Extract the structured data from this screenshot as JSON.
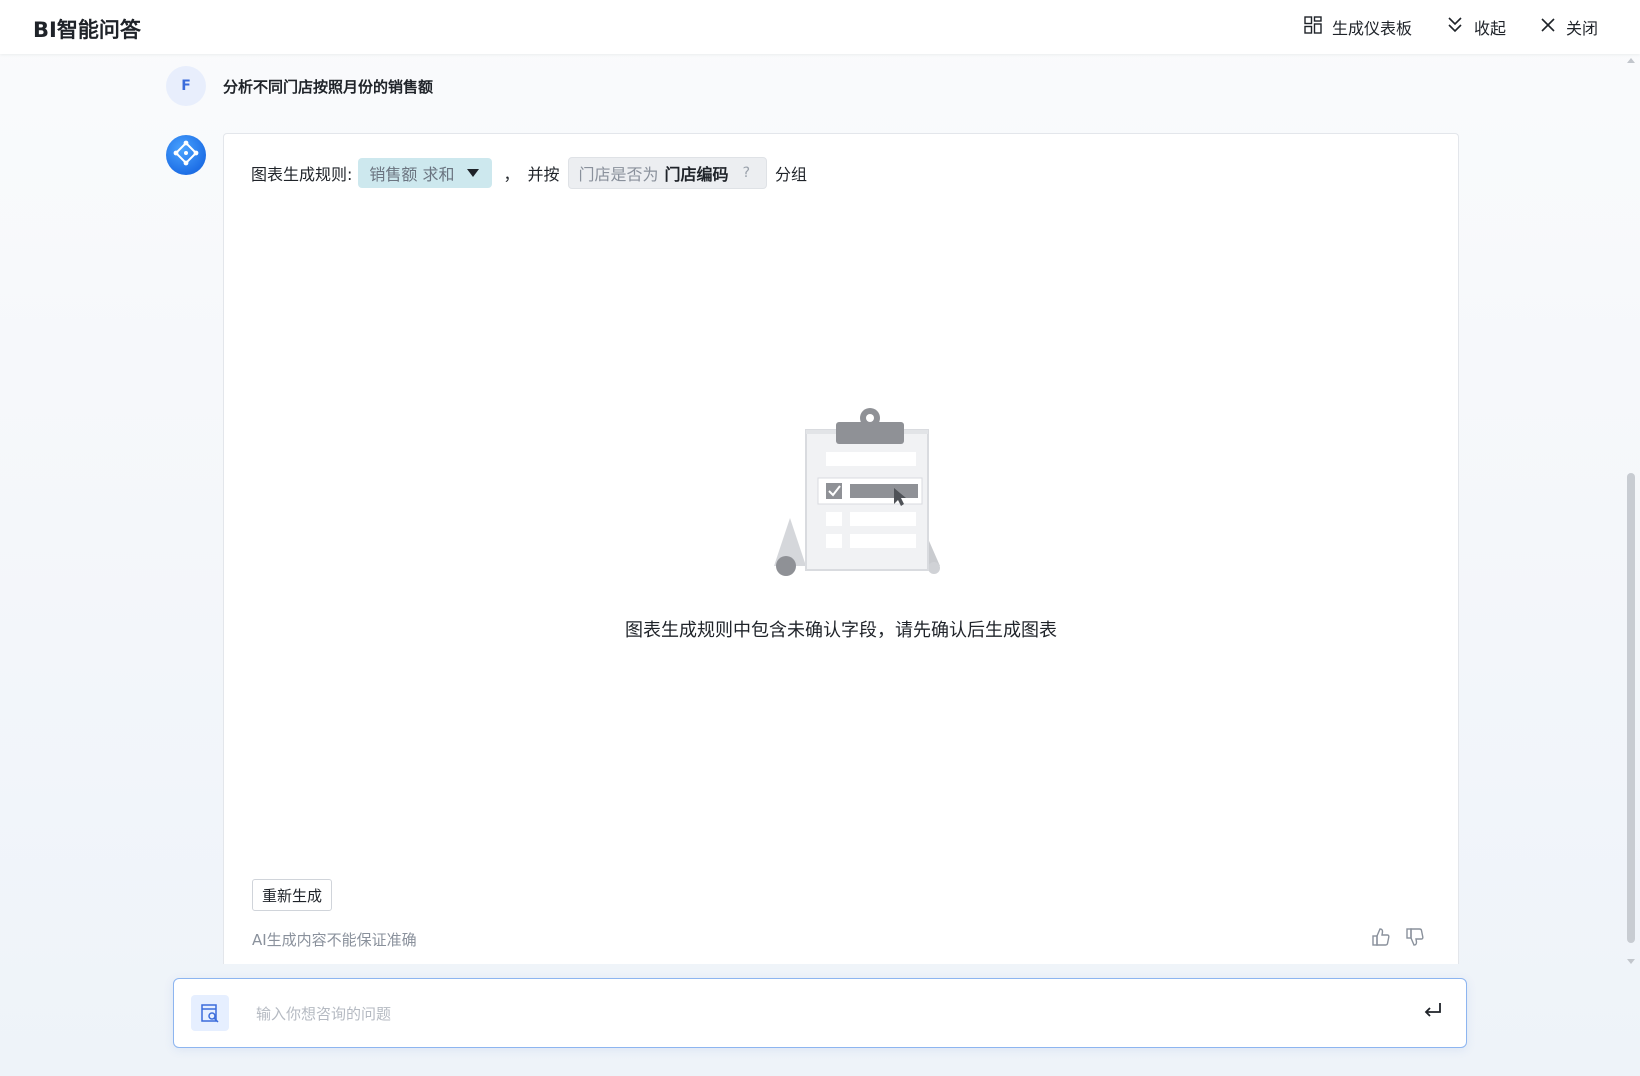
{
  "header": {
    "title": "BI智能问答",
    "actions": [
      {
        "label": "生成仪表板",
        "icon": "dashboard-icon"
      },
      {
        "label": "收起",
        "icon": "chevron-double-down-icon"
      },
      {
        "label": "关闭",
        "icon": "close-icon"
      }
    ]
  },
  "conversation": {
    "user": {
      "avatar_letter": "F",
      "question": "分析不同门店按照月份的销售额"
    },
    "answer": {
      "rule_prefix": "图表生成规则:",
      "measure_chip": "销售额 求和",
      "comma": "，",
      "group_by_text": "并按",
      "group_chip_prefix": "门店是否为",
      "group_chip_field": "门店编码",
      "group_chip_question": "?",
      "group_suffix": "分组",
      "empty_message": "图表生成规则中包含未确认字段，请先确认后生成图表",
      "regenerate_label": "重新生成",
      "disclaimer": "AI生成内容不能保证准确"
    }
  },
  "input": {
    "placeholder": "输入你想咨询的问题",
    "value": ""
  },
  "colors": {
    "accent": "#3b6cdb",
    "measure_chip_bg": "#cde8ee",
    "input_border": "#8db5f0"
  }
}
